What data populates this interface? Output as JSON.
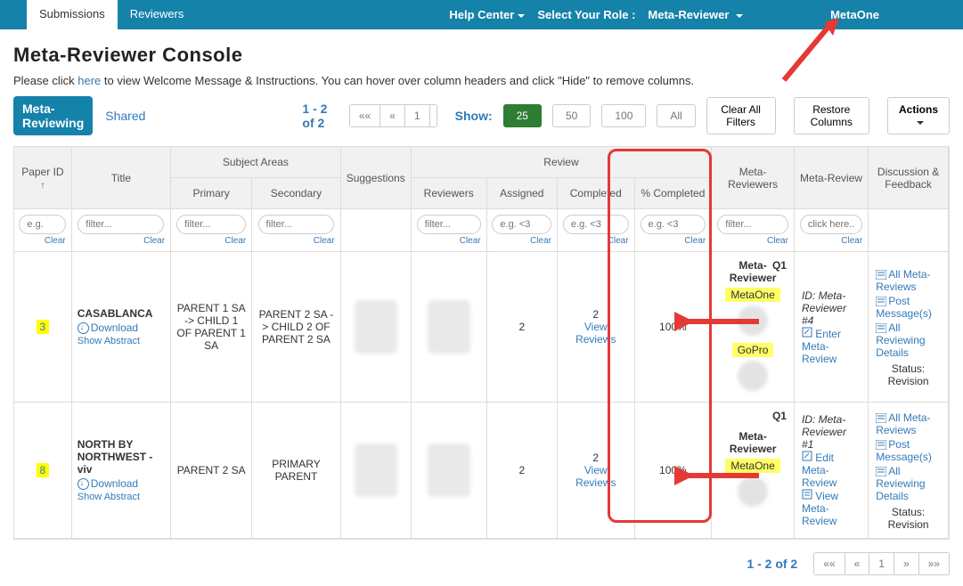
{
  "topbar": {
    "tabs": {
      "submissions": "Submissions",
      "reviewers": "Reviewers"
    },
    "help": "Help Center",
    "role_label": "Select Your Role :",
    "role_value": "Meta-Reviewer",
    "user": "MetaOne"
  },
  "page_title": "Meta-Reviewer Console",
  "instr_pre": "Please click ",
  "instr_here": "here",
  "instr_post": " to view Welcome Message & Instructions. You can hover over column headers and click \"Hide\" to remove columns.",
  "controls": {
    "metarev": "Meta-Reviewing",
    "shared": "Shared",
    "range": "1 - 2 of 2",
    "pgr_first": "««",
    "pgr_prev": "«",
    "pgr_1": "1",
    "pgr_next": "»",
    "pgr_last": "»»",
    "show": "Show:",
    "s25": "25",
    "s50": "50",
    "s100": "100",
    "sAll": "All",
    "clearall": "Clear All Filters",
    "restore": "Restore Columns",
    "actions": "Actions"
  },
  "headers": {
    "paperid": "Paper ID",
    "title": "Title",
    "subject": "Subject Areas",
    "primary": "Primary",
    "secondary": "Secondary",
    "suggestions": "Suggestions",
    "review": "Review",
    "reviewers": "Reviewers",
    "assigned": "Assigned",
    "completed": "Completed",
    "pct": "% Completed",
    "metareviewers": "Meta-Reviewers",
    "metareview": "Meta-Review",
    "discussion": "Discussion & Feedback"
  },
  "filters": {
    "eg": "e.g.",
    "filter": "filter...",
    "eglt3": "e.g. <3",
    "click": "click here...",
    "clear": "Clear"
  },
  "rows": [
    {
      "id": "3",
      "title": "CASABLANCA",
      "download": "Download",
      "abstract": "Show Abstract",
      "primary": "PARENT 1 SA -> CHILD 1 OF PARENT 1 SA",
      "secondary": "PARENT 2 SA -> CHILD 2 OF PARENT 2 SA",
      "assigned": "2",
      "completed_n": "2",
      "viewrev": "View Reviews",
      "pct": "100%",
      "mr_head": "Meta-Reviewer",
      "q": "Q1",
      "mr1": "MetaOne",
      "mr2": "GoPro",
      "mr_id": "ID: Meta-Reviewer #4",
      "mr_action": "Enter Meta-Review",
      "df_allmeta": "All Meta-Reviews",
      "df_post": "Post Message(s)",
      "df_alldet": "All Reviewing Details",
      "status": "Status: Revision"
    },
    {
      "id": "8",
      "title": "NORTH BY NORTHWEST - viv",
      "download": "Download",
      "abstract": "Show Abstract",
      "primary": "PARENT 2 SA",
      "secondary": "PRIMARY PARENT",
      "assigned": "2",
      "completed_n": "2",
      "viewrev": "View Reviews",
      "pct": "100%",
      "mr_head": "Meta-Reviewer",
      "q": "Q1",
      "mr1": "MetaOne",
      "mr_id": "ID: Meta-Reviewer #1",
      "mr_action1": "Edit Meta-Review",
      "mr_action2": "View Meta-Review",
      "df_allmeta": "All Meta-Reviews",
      "df_post": "Post Message(s)",
      "df_alldet": "All Reviewing Details",
      "status": "Status: Revision"
    }
  ]
}
